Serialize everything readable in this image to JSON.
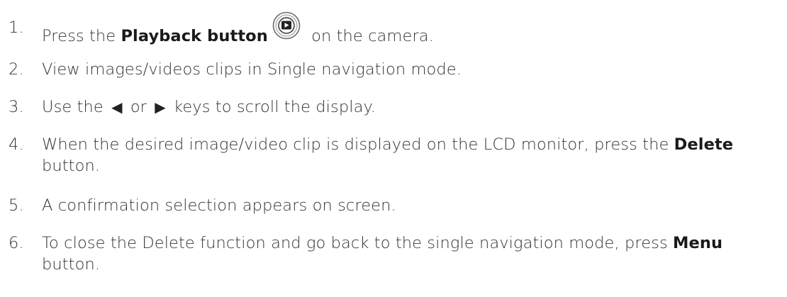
{
  "steps": [
    {
      "num": "1.",
      "pre": "Press the ",
      "bold": "Playback button",
      "icon": "playback-icon",
      "post": " on the camera."
    },
    {
      "num": "2.",
      "text": "View images/videos clips in Single navigation mode."
    },
    {
      "num": "3.",
      "pre": "Use the ",
      "left_key": "◀",
      "mid": " or ",
      "right_key": "▶",
      "post": " keys to scroll the display."
    },
    {
      "num": "4.",
      "pre": "When the desired image/video clip is displayed on the LCD monitor, press the ",
      "bold": "Delete",
      "post": " button."
    },
    {
      "num": "5.",
      "text": "A confirmation selection appears on screen."
    },
    {
      "num": "6.",
      "pre": "To close the Delete function and go back to the single navigation mode, press ",
      "bold": "Menu",
      "post": " button."
    }
  ]
}
